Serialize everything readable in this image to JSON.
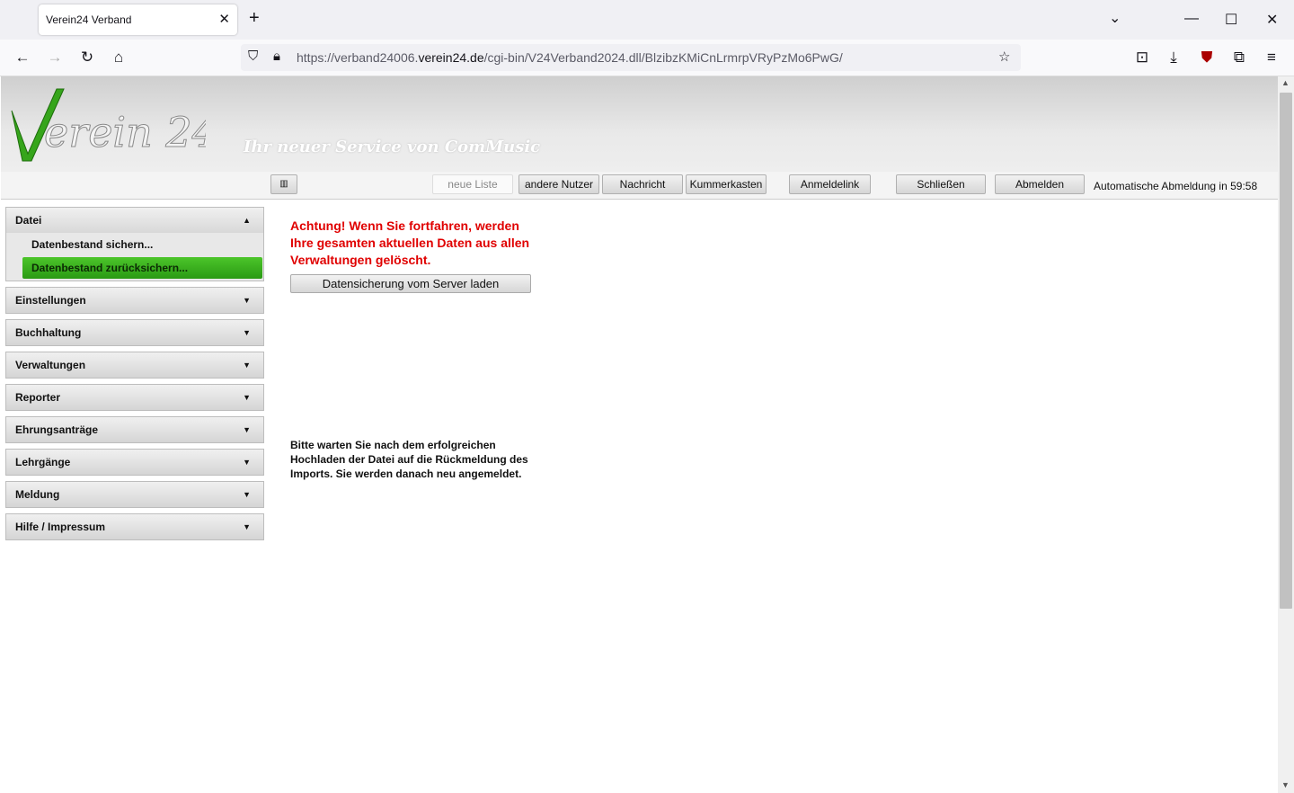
{
  "browser": {
    "tab_title": "Verein24 Verband",
    "tab_close": "✕",
    "new_tab": "+",
    "url_prefix": "https://verband24006.",
    "url_domain": "verein24.de",
    "url_suffix": "/cgi-bin/V24Verband2024.dll/BlzibzKMiCnLrmrpVRyPzMo6PwG/"
  },
  "banner": {
    "logo_text": "Verein 24",
    "tagline": "Ihr neuer Service von ComMusic"
  },
  "toolbar": {
    "list_icon": "▥",
    "new_list": "neue Liste",
    "other_users": "andere Nutzer",
    "message": "Nachricht",
    "complaints": "Kummerkasten",
    "login_link": "Anmeldelink",
    "close": "Schließen",
    "logout": "Abmelden",
    "auto_logout": "Automatische Abmeldung in 59:58"
  },
  "menu": {
    "datei": "Datei",
    "datei_items": [
      "Datenbestand sichern...",
      "Datenbestand zurücksichern..."
    ],
    "sections": [
      "Einstellungen",
      "Buchhaltung",
      "Verwaltungen",
      "Reporter",
      "Ehrungsanträge",
      "Lehrgänge",
      "Meldung",
      "Hilfe / Impressum"
    ]
  },
  "content": {
    "warning": "Achtung! Wenn Sie fortfahren, werden Ihre gesamten aktuellen Daten aus allen Verwaltungen gelöscht.",
    "load_button": "Datensicherung vom Server laden",
    "note": "Bitte warten Sie nach dem erfolgreichen Hochladen der Datei auf die Rückmeldung des Imports. Sie werden danach neu angemeldet."
  },
  "colors": {
    "warning": "#e00000",
    "active_green": "#3db322"
  }
}
